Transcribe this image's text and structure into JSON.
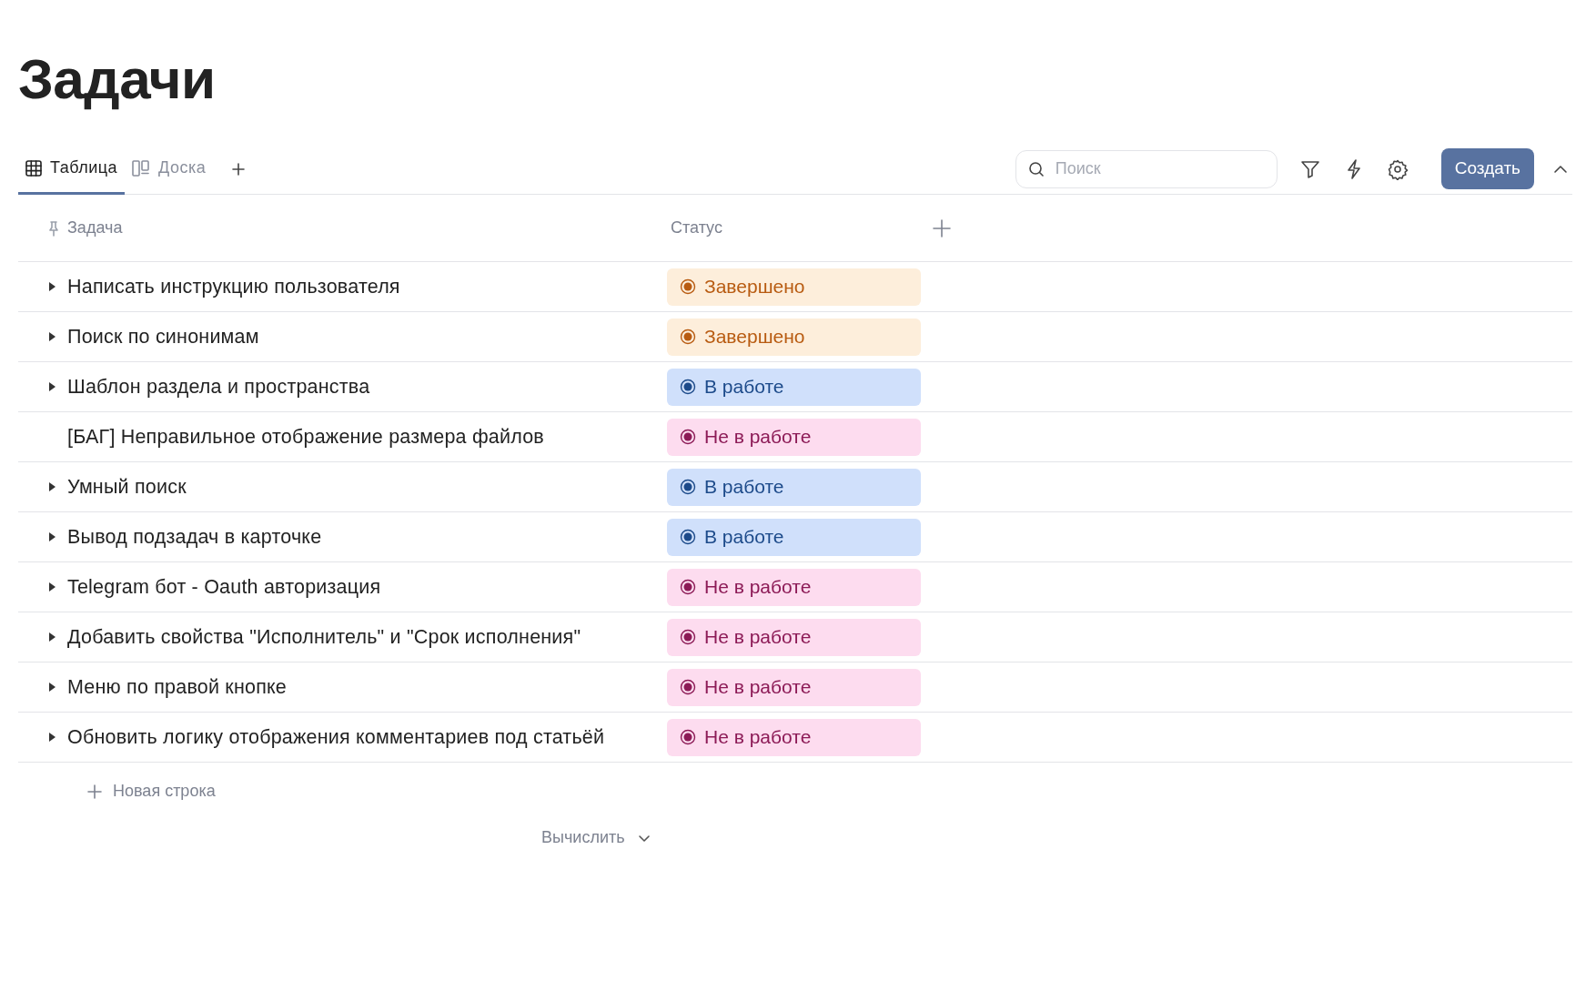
{
  "page_title": "Задачи",
  "tabs": [
    {
      "label": "Таблица",
      "kind": "table",
      "selected": true
    },
    {
      "label": "Доска",
      "kind": "board",
      "selected": false
    }
  ],
  "search": {
    "placeholder": "Поиск"
  },
  "create_button": "Создать",
  "columns": [
    "Задача",
    "Статус"
  ],
  "rows": [
    {
      "task": "Написать инструкцию пользователя",
      "expandable": true,
      "status": {
        "kind": "done",
        "label": "Завершено"
      }
    },
    {
      "task": "Поиск по синонимам",
      "expandable": true,
      "status": {
        "kind": "done",
        "label": "Завершено"
      }
    },
    {
      "task": "Шаблон раздела и пространства",
      "expandable": true,
      "status": {
        "kind": "progress",
        "label": "В работе"
      }
    },
    {
      "task": "[БАГ] Неправильное отображение размера файлов",
      "expandable": false,
      "status": {
        "kind": "todo",
        "label": "Не в работе"
      }
    },
    {
      "task": "Умный поиск",
      "expandable": true,
      "status": {
        "kind": "progress",
        "label": "В работе"
      }
    },
    {
      "task": "Вывод подзадач в карточке",
      "expandable": true,
      "status": {
        "kind": "progress",
        "label": "В работе"
      }
    },
    {
      "task": "Telegram бот - Oauth авторизация",
      "expandable": true,
      "status": {
        "kind": "todo",
        "label": "Не в работе"
      }
    },
    {
      "task": "Добавить свойства \"Исполнитель\" и \"Срок исполнения\"",
      "expandable": true,
      "status": {
        "kind": "todo",
        "label": "Не в работе"
      }
    },
    {
      "task": "Меню по правой кнопке",
      "expandable": true,
      "status": {
        "kind": "todo",
        "label": "Не в работе"
      }
    },
    {
      "task": "Обновить логику отображения комментариев под статьёй",
      "expandable": true,
      "status": {
        "kind": "todo",
        "label": "Не в работе"
      }
    }
  ],
  "new_row": "Новая строка",
  "calculate": "Вычислить"
}
